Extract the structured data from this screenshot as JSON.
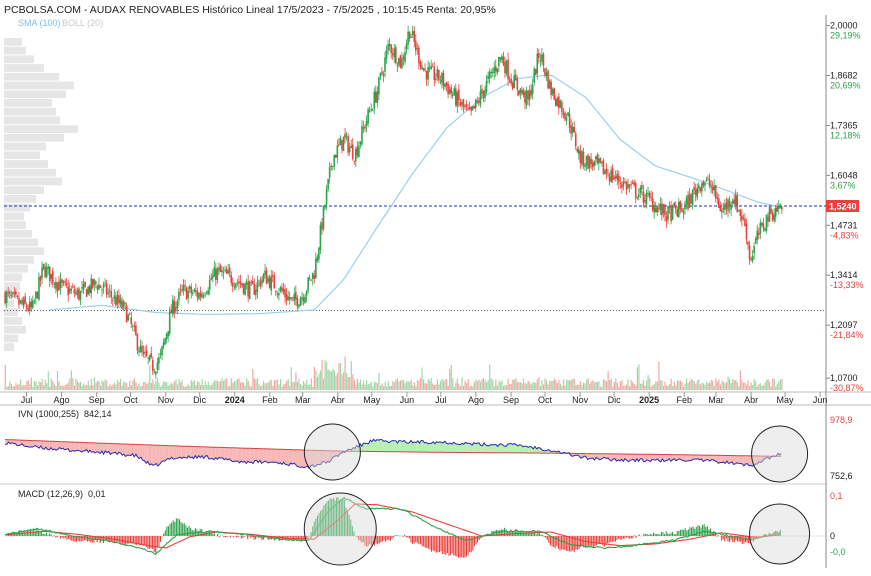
{
  "header": {
    "title": "PCBOLSA.COM - AUDAX RENOVABLES Histórico Lineal 17/5/2023 - 7/5/2025 , 10:15:45 Renta: 20,95%",
    "sma_label": "SMA (100)",
    "boll_label": "BOLL (20)"
  },
  "colors": {
    "up": "#2ca24a",
    "down": "#e8413c",
    "sma": "#9ccff0",
    "price_line": "#1f2fb8",
    "ivn_line": "#2a2aa8",
    "ivn_fill_below": "#f7b6b6",
    "ivn_fill_above": "#b6f0b0",
    "macd_line": "#2ca24a",
    "signal_line": "#e8413c",
    "volume_profile": "#e6e6e6",
    "circle_fill": "#d9d9d9"
  },
  "chart_data": [
    {
      "type": "candlestick",
      "title": "PCBOLSA.COM - AUDAX RENOVABLES Histórico Lineal 17/5/2023 - 7/5/2025 , 10:15:45 Renta: 20,95%",
      "x_start": "2023-05-17",
      "x_end": "2025-05-07",
      "x_axis_range": [
        "2023-06-20",
        "2025-06-15"
      ],
      "y_axis_range": [
        1.065,
        2.02
      ],
      "month_ticks": [
        "Jul",
        "Ago",
        "Sep",
        "Oct",
        "Nov",
        "Dic",
        "2024",
        "Feb",
        "Mar",
        "Abr",
        "May",
        "Jun",
        "Jul",
        "Ago",
        "Sep",
        "Oct",
        "Nov",
        "Dic",
        "2025",
        "Feb",
        "Mar",
        "Abr",
        "May",
        "Jun"
      ],
      "price_ticks": [
        {
          "value": 2.0,
          "label": "2,0000",
          "pct": "29,19%"
        },
        {
          "value": 1.8682,
          "label": "1,8682",
          "pct": "20,69%"
        },
        {
          "value": 1.7365,
          "label": "1,7365",
          "pct": "12,18%"
        },
        {
          "value": 1.6048,
          "label": "1,6048",
          "pct": "3,67%"
        },
        {
          "value": 1.4731,
          "label": "1,4731",
          "pct": "-4,83%"
        },
        {
          "value": 1.3414,
          "label": "1,3414",
          "pct": "-13,33%"
        },
        {
          "value": 1.2097,
          "label": "1,2097",
          "pct": "-21,84%"
        },
        {
          "value": 1.07,
          "label": "1,0700",
          "pct": "-30,87%"
        }
      ],
      "last_price": {
        "value": 1.524,
        "label": "1,5240"
      },
      "reference_level": 1.248,
      "close_series": [
        [
          "2023-06-21",
          1.29
        ],
        [
          "2023-07-01",
          1.27
        ],
        [
          "2023-07-15",
          1.25
        ],
        [
          "2023-07-25",
          1.36
        ],
        [
          "2023-08-10",
          1.31
        ],
        [
          "2023-08-25",
          1.29
        ],
        [
          "2023-09-10",
          1.32
        ],
        [
          "2023-09-25",
          1.28
        ],
        [
          "2023-10-05",
          1.25
        ],
        [
          "2023-10-20",
          1.13
        ],
        [
          "2023-10-30",
          1.1
        ],
        [
          "2023-11-05",
          1.12
        ],
        [
          "2023-11-15",
          1.25
        ],
        [
          "2023-11-25",
          1.3
        ],
        [
          "2023-12-10",
          1.29
        ],
        [
          "2023-12-25",
          1.35
        ],
        [
          "2024-01-10",
          1.33
        ],
        [
          "2024-01-25",
          1.3
        ],
        [
          "2024-02-05",
          1.34
        ],
        [
          "2024-02-20",
          1.3
        ],
        [
          "2024-03-01",
          1.27
        ],
        [
          "2024-03-10",
          1.29
        ],
        [
          "2024-03-20",
          1.35
        ],
        [
          "2024-03-28",
          1.5
        ],
        [
          "2024-04-05",
          1.65
        ],
        [
          "2024-04-15",
          1.7
        ],
        [
          "2024-04-25",
          1.66
        ],
        [
          "2024-05-05",
          1.75
        ],
        [
          "2024-05-15",
          1.83
        ],
        [
          "2024-05-25",
          1.95
        ],
        [
          "2024-06-05",
          1.9
        ],
        [
          "2024-06-12",
          1.99
        ],
        [
          "2024-06-25",
          1.88
        ],
        [
          "2024-07-10",
          1.86
        ],
        [
          "2024-07-25",
          1.8
        ],
        [
          "2024-08-05",
          1.76
        ],
        [
          "2024-08-20",
          1.85
        ],
        [
          "2024-09-01",
          1.92
        ],
        [
          "2024-09-10",
          1.86
        ],
        [
          "2024-09-25",
          1.8
        ],
        [
          "2024-10-05",
          1.93
        ],
        [
          "2024-10-15",
          1.83
        ],
        [
          "2024-10-30",
          1.76
        ],
        [
          "2024-11-10",
          1.65
        ],
        [
          "2024-11-25",
          1.63
        ],
        [
          "2024-12-10",
          1.6
        ],
        [
          "2024-12-25",
          1.57
        ],
        [
          "2025-01-10",
          1.54
        ],
        [
          "2025-01-25",
          1.5
        ],
        [
          "2025-02-10",
          1.52
        ],
        [
          "2025-02-25",
          1.59
        ],
        [
          "2025-03-05",
          1.58
        ],
        [
          "2025-03-15",
          1.51
        ],
        [
          "2025-03-25",
          1.55
        ],
        [
          "2025-04-05",
          1.47
        ],
        [
          "2025-04-09",
          1.38
        ],
        [
          "2025-04-15",
          1.44
        ],
        [
          "2025-04-25",
          1.5
        ],
        [
          "2025-05-07",
          1.524
        ]
      ],
      "sma_series": [
        [
          "2023-07-30",
          1.25
        ],
        [
          "2023-09-15",
          1.262
        ],
        [
          "2023-11-01",
          1.243
        ],
        [
          "2023-12-15",
          1.238
        ],
        [
          "2024-02-01",
          1.24
        ],
        [
          "2024-03-20",
          1.25
        ],
        [
          "2024-04-15",
          1.33
        ],
        [
          "2024-05-15",
          1.47
        ],
        [
          "2024-06-15",
          1.61
        ],
        [
          "2024-07-15",
          1.73
        ],
        [
          "2024-08-15",
          1.81
        ],
        [
          "2024-09-15",
          1.86
        ],
        [
          "2024-10-15",
          1.87
        ],
        [
          "2024-11-15",
          1.81
        ],
        [
          "2024-12-15",
          1.7
        ],
        [
          "2025-01-15",
          1.63
        ],
        [
          "2025-02-15",
          1.6
        ],
        [
          "2025-03-15",
          1.57
        ],
        [
          "2025-04-15",
          1.535
        ],
        [
          "2025-05-07",
          1.52
        ]
      ]
    },
    {
      "type": "area",
      "title": "IVN (1000,255)",
      "value_label": "842,14",
      "y_axis_range": [
        752.6,
        978.9
      ],
      "tick_labels": [
        {
          "value": 978.9,
          "label": "978,9"
        },
        {
          "value": 752.6,
          "label": "752,6"
        }
      ],
      "series": [
        {
          "name": "IVN",
          "values": [
            [
              "2023-06-21",
              888
            ],
            [
              "2023-07-15",
              870
            ],
            [
              "2023-08-15",
              858
            ],
            [
              "2023-09-15",
              848
            ],
            [
              "2023-10-15",
              834
            ],
            [
              "2023-10-30",
              790
            ],
            [
              "2023-11-15",
              826
            ],
            [
              "2023-12-15",
              830
            ],
            [
              "2024-01-15",
              810
            ],
            [
              "2024-02-15",
              808
            ],
            [
              "2024-03-15",
              790
            ],
            [
              "2024-04-01",
              810
            ],
            [
              "2024-04-15",
              850
            ],
            [
              "2024-05-10",
              895
            ],
            [
              "2024-06-10",
              890
            ],
            [
              "2024-07-10",
              890
            ],
            [
              "2024-08-15",
              880
            ],
            [
              "2024-09-15",
              878
            ],
            [
              "2024-10-15",
              858
            ],
            [
              "2024-11-15",
              825
            ],
            [
              "2024-12-15",
              818
            ],
            [
              "2025-01-15",
              815
            ],
            [
              "2025-02-15",
              818
            ],
            [
              "2025-03-15",
              810
            ],
            [
              "2025-04-09",
              795
            ],
            [
              "2025-04-25",
              825
            ],
            [
              "2025-05-07",
              842.14
            ]
          ]
        },
        {
          "name": "",
          "values": [
            [
              "2023-06-21",
              900
            ],
            [
              "2023-09-15",
              885
            ],
            [
              "2023-12-15",
              870
            ],
            [
              "2024-03-15",
              857
            ],
            [
              "2024-04-15",
              853
            ],
            [
              "2024-07-15",
              848
            ],
            [
              "2024-10-15",
              845
            ],
            [
              "2025-01-15",
              840
            ],
            [
              "2025-05-07",
              832
            ]
          ]
        }
      ]
    },
    {
      "type": "line",
      "title": "MACD (12,26,9)",
      "value_label": "0,01",
      "y_axis_range": [
        -0.07,
        0.11
      ],
      "tick_labels": [
        {
          "value": 0.1,
          "label": "0,1"
        },
        {
          "value": 0.0,
          "label": "0"
        },
        {
          "value": -0.04,
          "label": "-0,0"
        }
      ],
      "series": [
        {
          "name": "MACD",
          "values": [
            [
              "2023-06-21",
              0.005
            ],
            [
              "2023-07-20",
              0.018
            ],
            [
              "2023-08-20",
              0.0
            ],
            [
              "2023-09-20",
              -0.012
            ],
            [
              "2023-10-20",
              -0.032
            ],
            [
              "2023-11-01",
              -0.045
            ],
            [
              "2023-11-20",
              0.004
            ],
            [
              "2023-12-20",
              0.012
            ],
            [
              "2024-01-20",
              0.003
            ],
            [
              "2024-02-20",
              -0.008
            ],
            [
              "2024-03-15",
              -0.012
            ],
            [
              "2024-04-01",
              0.06
            ],
            [
              "2024-04-15",
              0.095
            ],
            [
              "2024-05-05",
              0.068
            ],
            [
              "2024-06-05",
              0.068
            ],
            [
              "2024-07-01",
              0.028
            ],
            [
              "2024-08-01",
              -0.012
            ],
            [
              "2024-09-01",
              0.012
            ],
            [
              "2024-10-05",
              0.012
            ],
            [
              "2024-11-01",
              -0.022
            ],
            [
              "2024-12-01",
              -0.03
            ],
            [
              "2025-01-01",
              -0.022
            ],
            [
              "2025-02-01",
              -0.01
            ],
            [
              "2025-03-01",
              0.012
            ],
            [
              "2025-04-09",
              -0.01
            ],
            [
              "2025-05-07",
              0.01
            ]
          ]
        },
        {
          "name": "",
          "values": [
            [
              "2023-06-21",
              0.003
            ],
            [
              "2023-07-25",
              0.012
            ],
            [
              "2023-08-25",
              0.004
            ],
            [
              "2023-09-25",
              -0.008
            ],
            [
              "2023-10-25",
              -0.024
            ],
            [
              "2023-11-10",
              -0.03
            ],
            [
              "2023-12-01",
              -0.002
            ],
            [
              "2023-12-25",
              0.01
            ],
            [
              "2024-01-25",
              0.004
            ],
            [
              "2024-02-25",
              -0.006
            ],
            [
              "2024-03-20",
              -0.008
            ],
            [
              "2024-04-10",
              0.04
            ],
            [
              "2024-04-25",
              0.08
            ],
            [
              "2024-05-15",
              0.078
            ],
            [
              "2024-06-15",
              0.06
            ],
            [
              "2024-07-15",
              0.03
            ],
            [
              "2024-08-15",
              0.0
            ],
            [
              "2024-09-15",
              0.006
            ],
            [
              "2024-10-15",
              0.01
            ],
            [
              "2024-11-15",
              -0.014
            ],
            [
              "2024-12-15",
              -0.024
            ],
            [
              "2025-01-15",
              -0.02
            ],
            [
              "2025-02-15",
              -0.008
            ],
            [
              "2025-03-15",
              0.008
            ],
            [
              "2025-04-15",
              -0.004
            ],
            [
              "2025-05-07",
              0.004
            ]
          ]
        }
      ]
    }
  ]
}
